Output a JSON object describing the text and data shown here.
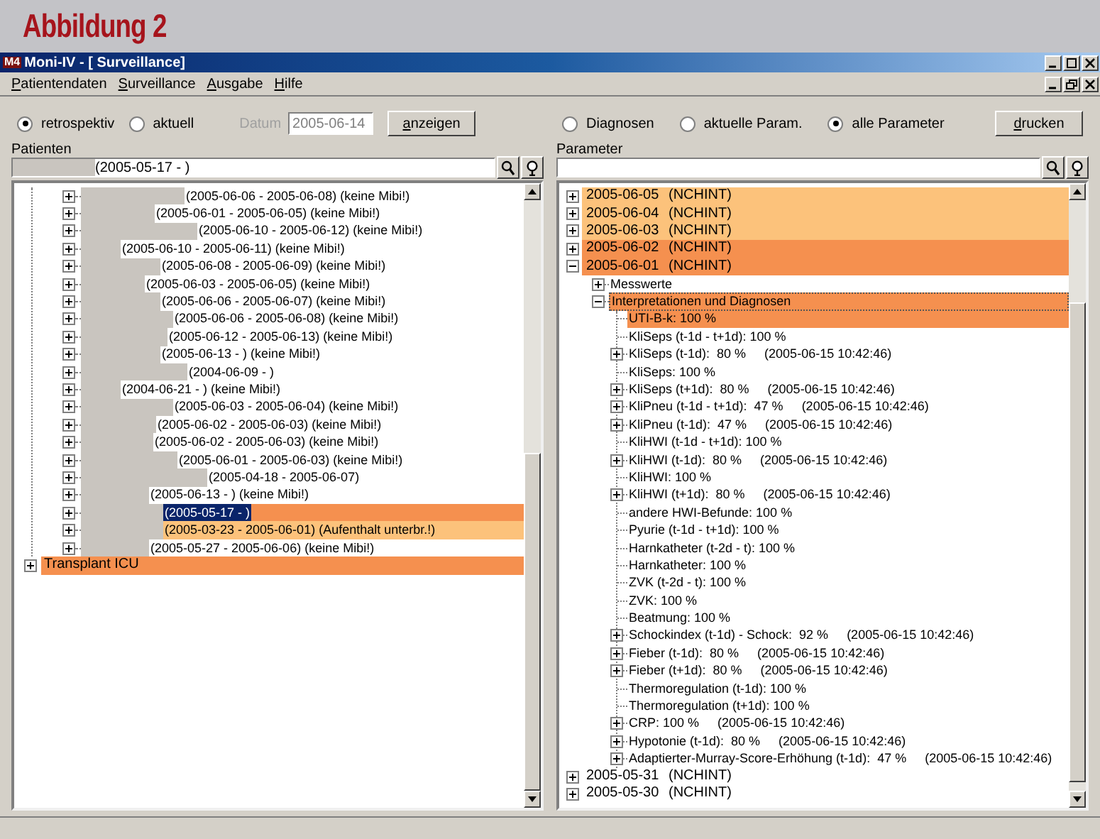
{
  "figure_title": "Abbildung 2",
  "window": {
    "app_icon": "M4",
    "title": "Moni-IV - [ Surveillance]"
  },
  "menu": [
    "Patientendaten",
    "Surveillance",
    "Ausgabe",
    "Hilfe"
  ],
  "view_mode": [
    {
      "label": "retrospektiv",
      "selected": true
    },
    {
      "label": "aktuell",
      "selected": false
    }
  ],
  "date_field": {
    "label": "Datum",
    "value": "2005-06-14",
    "disabled": true
  },
  "show_button": "anzeigen",
  "param_mode": [
    {
      "label": "Diagnosen",
      "selected": false
    },
    {
      "label": "aktuelle Param.",
      "selected": false
    },
    {
      "label": "alle Parameter",
      "selected": true
    }
  ],
  "print_button": "drucken",
  "patients": {
    "label": "Patienten",
    "search_value": "(2005-05-17 - )",
    "rows": [
      {
        "text": "(2005-06-06 - 2005-06-08) (keine Mibi!)",
        "expanded": false,
        "selected": false
      },
      {
        "text": "(2005-06-01 - 2005-06-05) (keine Mibi!)",
        "expanded": false,
        "selected": false
      },
      {
        "text": "(2005-06-10 - 2005-06-12) (keine Mibi!)",
        "expanded": false,
        "selected": false
      },
      {
        "text": "(2005-06-10 - 2005-06-11) (keine Mibi!)",
        "expanded": false,
        "selected": false
      },
      {
        "text": "(2005-06-08 - 2005-06-09) (keine Mibi!)",
        "expanded": false,
        "selected": false
      },
      {
        "text": "(2005-06-03 - 2005-06-05) (keine Mibi!)",
        "expanded": false,
        "selected": false
      },
      {
        "text": "(2005-06-06 - 2005-06-07) (keine Mibi!)",
        "expanded": false,
        "selected": false
      },
      {
        "text": "(2005-06-06 - 2005-06-08) (keine Mibi!)",
        "expanded": false,
        "selected": false
      },
      {
        "text": "(2005-06-12 - 2005-06-13) (keine Mibi!)",
        "expanded": false,
        "selected": false
      },
      {
        "text": "(2005-06-13 - ) (keine Mibi!)",
        "expanded": false,
        "selected": false
      },
      {
        "text": "(2004-06-09 - )",
        "expanded": false,
        "selected": false
      },
      {
        "text": "(2004-06-21 - ) (keine Mibi!)",
        "expanded": false,
        "selected": false
      },
      {
        "text": "(2005-06-03 - 2005-06-04) (keine Mibi!)",
        "expanded": false,
        "selected": false
      },
      {
        "text": "(2005-06-02 - 2005-06-03) (keine Mibi!)",
        "expanded": false,
        "selected": false
      },
      {
        "text": "(2005-06-02 - 2005-06-03) (keine Mibi!)",
        "expanded": false,
        "selected": false
      },
      {
        "text": "(2005-06-01 - 2005-06-03) (keine Mibi!)",
        "expanded": false,
        "selected": false
      },
      {
        "text": "(2005-04-18 - 2005-06-07)",
        "expanded": false,
        "selected": false
      },
      {
        "text": "(2005-06-13 - ) (keine Mibi!)",
        "expanded": false,
        "selected": false
      },
      {
        "text": "(2005-05-17 - )",
        "expanded": false,
        "selected": true,
        "color": "#f5904f"
      },
      {
        "text": "(2005-03-23 - 2005-06-01) (Aufenthalt unterbr.!)",
        "expanded": false,
        "selected": false,
        "color": "#fcc27b"
      },
      {
        "text": "(2005-05-27 - 2005-06-06) (keine Mibi!)",
        "expanded": false,
        "selected": false
      }
    ],
    "groups": [
      {
        "label": "Transplant ICU",
        "expanded": false,
        "color": "#f5904f"
      }
    ]
  },
  "parameters": {
    "label": "Parameter",
    "days": [
      {
        "date": "2005-06-05",
        "tag": "(NCHINT)",
        "expanded": false,
        "color": "#fcc27b"
      },
      {
        "date": "2005-06-04",
        "tag": "(NCHINT)",
        "expanded": false,
        "color": "#fcc27b"
      },
      {
        "date": "2005-06-03",
        "tag": "(NCHINT)",
        "expanded": false,
        "color": "#fcc27b"
      },
      {
        "date": "2005-06-02",
        "tag": "(NCHINT)",
        "expanded": false,
        "color": "#f5904f"
      },
      {
        "date": "2005-06-01",
        "tag": "(NCHINT)",
        "expanded": true,
        "color": "#f5904f",
        "children": [
          {
            "label": "Messwerte",
            "expanded": false
          },
          {
            "label": "Interpretationen und Diagnosen",
            "expanded": true,
            "color": "#f5904f",
            "children": [
              {
                "kind": "leaf",
                "label": "UTI-B-k: 100 %",
                "color": "#f5904f"
              },
              {
                "kind": "leaf",
                "label": "KliSeps (t-1d - t+1d): 100 %"
              },
              {
                "kind": "node",
                "label": "KliSeps (t-1d):  80 %",
                "timestamp": "(2005-06-15 10:42:46)",
                "expanded": false
              },
              {
                "kind": "leaf",
                "label": "KliSeps: 100 %"
              },
              {
                "kind": "node",
                "label": "KliSeps (t+1d):  80 %",
                "timestamp": "(2005-06-15 10:42:46)",
                "expanded": false
              },
              {
                "kind": "node",
                "label": "KliPneu (t-1d - t+1d):  47 %",
                "timestamp": "(2005-06-15 10:42:46)",
                "expanded": false
              },
              {
                "kind": "node",
                "label": "KliPneu (t-1d):  47 %",
                "timestamp": "(2005-06-15 10:42:46)",
                "expanded": false
              },
              {
                "kind": "leaf",
                "label": "KliHWI (t-1d - t+1d): 100 %"
              },
              {
                "kind": "node",
                "label": "KliHWI (t-1d):  80 %",
                "timestamp": "(2005-06-15 10:42:46)",
                "expanded": false
              },
              {
                "kind": "leaf",
                "label": "KliHWI: 100 %"
              },
              {
                "kind": "node",
                "label": "KliHWI (t+1d):  80 %",
                "timestamp": "(2005-06-15 10:42:46)",
                "expanded": false
              },
              {
                "kind": "leaf",
                "label": "andere HWI-Befunde: 100 %"
              },
              {
                "kind": "leaf",
                "label": "Pyurie (t-1d - t+1d): 100 %"
              },
              {
                "kind": "leaf",
                "label": "Harnkatheter (t-2d - t): 100 %"
              },
              {
                "kind": "leaf",
                "label": "Harnkatheter: 100 %"
              },
              {
                "kind": "leaf",
                "label": "ZVK (t-2d - t): 100 %"
              },
              {
                "kind": "leaf",
                "label": "ZVK: 100 %"
              },
              {
                "kind": "leaf",
                "label": "Beatmung: 100 %"
              },
              {
                "kind": "node",
                "label": "Schockindex (t-1d) - Schock:  92 %",
                "timestamp": "(2005-06-15 10:42:46)",
                "expanded": false
              },
              {
                "kind": "node",
                "label": "Fieber (t-1d):  80 %",
                "timestamp": "(2005-06-15 10:42:46)",
                "expanded": false
              },
              {
                "kind": "node",
                "label": "Fieber (t+1d):  80 %",
                "timestamp": "(2005-06-15 10:42:46)",
                "expanded": false
              },
              {
                "kind": "leaf",
                "label": "Thermoregulation (t-1d): 100 %"
              },
              {
                "kind": "leaf",
                "label": "Thermoregulation (t+1d): 100 %"
              },
              {
                "kind": "node",
                "label": "CRP: 100 %",
                "timestamp": "(2005-06-15 10:42:46)",
                "expanded": false
              },
              {
                "kind": "node",
                "label": "Hypotonie (t-1d):  80 %",
                "timestamp": "(2005-06-15 10:42:46)",
                "expanded": false
              },
              {
                "kind": "node",
                "label": "Adaptierter-Murray-Score-Erhöhung (t-1d):  47 %",
                "timestamp": "(2005-06-15 10:42:46)",
                "expanded": false
              }
            ]
          }
        ]
      },
      {
        "date": "2005-05-31",
        "tag": "(NCHINT)",
        "expanded": false
      },
      {
        "date": "2005-05-30",
        "tag": "(NCHINT)",
        "expanded": false
      }
    ]
  }
}
